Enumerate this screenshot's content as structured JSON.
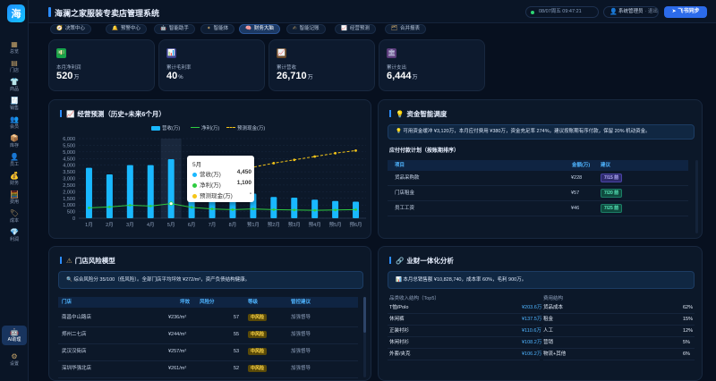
{
  "app": {
    "logo": "海",
    "title": "海澜之家服装专卖店管理系统",
    "datetime": "08/07周五 09:47:21",
    "user": "系统管理员",
    "logout": "· 退出",
    "feishu_btn": "飞书同步"
  },
  "sidebar": {
    "items": [
      {
        "label": "总览",
        "icon": "▦"
      },
      {
        "label": "门店",
        "icon": "▤"
      },
      {
        "label": "商品",
        "icon": "👕"
      },
      {
        "label": "销售",
        "icon": "🧾"
      },
      {
        "label": "会员",
        "icon": "👥"
      },
      {
        "label": "库存",
        "icon": "📦"
      },
      {
        "label": "员工",
        "icon": "👤"
      },
      {
        "label": "财务",
        "icon": "💰"
      },
      {
        "label": "费用",
        "icon": "🧮"
      },
      {
        "label": "成本",
        "icon": "🏷"
      },
      {
        "label": "利润",
        "icon": "💎"
      },
      {
        "label": "AI助理",
        "icon": "🤖"
      },
      {
        "label": "设置",
        "icon": "⚙"
      }
    ]
  },
  "tabs": [
    {
      "label": "决策中心",
      "icon": "🧭"
    },
    {
      "label": "预警中心",
      "icon": "🔔"
    },
    {
      "label": "智能助手",
      "icon": "🤖"
    },
    {
      "label": "智能体",
      "icon": "✦"
    },
    {
      "label": "财务大脑",
      "icon": "🧠"
    },
    {
      "label": "智能记账",
      "icon": "✍"
    },
    {
      "label": "经营预测",
      "icon": "📈"
    },
    {
      "label": "合并报表",
      "icon": "🗂"
    }
  ],
  "kpis": [
    {
      "label": "本月净利润",
      "value": "520",
      "unit": "万",
      "icon": "💵",
      "color": "#17a34a"
    },
    {
      "label": "累计毛利率",
      "value": "40",
      "unit": "%",
      "icon": "📊",
      "color": "#3a3f8f"
    },
    {
      "label": "累计营收",
      "value": "26,710",
      "unit": "万",
      "icon": "📈",
      "color": "#6b4a2a"
    },
    {
      "label": "累计支出",
      "value": "6,444",
      "unit": "万",
      "icon": "🏛",
      "color": "#5a3b7a"
    }
  ],
  "forecast": {
    "title": "经营预测（历史+未来6个月）",
    "icon": "📈",
    "legend": [
      "营收(万)",
      "净利(万)",
      "预测现金(万)"
    ],
    "tooltip": {
      "month": "5月",
      "rows": [
        {
          "name": "营收(万)",
          "value": "4,450",
          "color": "#19b8ff"
        },
        {
          "name": "净利(万)",
          "value": "1,100",
          "color": "#2ecc40"
        },
        {
          "name": "预测现金(万)",
          "value": "-",
          "color": "#f5c518"
        }
      ]
    }
  },
  "chart_data": {
    "type": "bar",
    "categories": [
      "1月",
      "2月",
      "3月",
      "4月",
      "5月",
      "6月",
      "7月",
      "8月",
      "预1月",
      "预2月",
      "预3月",
      "预4月",
      "预5月",
      "预6月"
    ],
    "ylim": [
      0,
      6000
    ],
    "yticks": [
      "0",
      "500",
      "1,000",
      "1,500",
      "2,000",
      "2,500",
      "3,000",
      "3,500",
      "4,000",
      "4,500",
      "5,000",
      "5,500",
      "6,000"
    ],
    "series": [
      {
        "name": "营收(万)",
        "type": "bar",
        "color": "#19b8ff",
        "values": [
          3800,
          3300,
          4000,
          4000,
          4450,
          3300,
          2350,
          2200,
          1850,
          1600,
          1550,
          1400,
          1300,
          1250
        ]
      },
      {
        "name": "净利(万)",
        "type": "line",
        "color": "#2ecc40",
        "values": [
          780,
          850,
          980,
          920,
          1100,
          820,
          700,
          650,
          700,
          650,
          620,
          600,
          620,
          650
        ]
      },
      {
        "name": "预测现金(万)",
        "type": "line-dashed",
        "color": "#f5c518",
        "values": [
          null,
          null,
          null,
          null,
          null,
          null,
          null,
          3400,
          3850,
          4150,
          4400,
          4650,
          4900,
          5100
        ]
      }
    ]
  },
  "capital": {
    "title": "资金智能调度",
    "icon": "💡",
    "notice": "💡 可用资金缓冲 ¥3,120万，本月应付费用 ¥380万，资金充足率 274%，建议按账期有序付款，保留 20% 机动资金。",
    "plan_title": "应付付款计划（按账期排序）",
    "columns": [
      "项目",
      "金额(万)",
      "建议"
    ],
    "rows": [
      {
        "item": "货品采购款",
        "amount": "¥228",
        "date": "7/15 前",
        "badge": "purple"
      },
      {
        "item": "门店租金",
        "amount": "¥57",
        "date": "7/20 前",
        "badge": "green"
      },
      {
        "item": "员工工资",
        "amount": "¥46",
        "date": "7/25 前",
        "badge": "green"
      }
    ]
  },
  "risk": {
    "title": "门店风险模型",
    "icon": "⚠",
    "notice": "🔍 综合风险分 35/100（低风险）。全部门店平均坪效 ¥272/m²，资产负债结构健康。",
    "columns": [
      "门店",
      "坪效",
      "风险分",
      "等级",
      "管控建议"
    ],
    "rows": [
      {
        "store": "南昌中山路店",
        "eff": "¥236/m²",
        "score": "57",
        "level": "中风险",
        "advice": "加强督导"
      },
      {
        "store": "郑州二七店",
        "eff": "¥244/m²",
        "score": "55",
        "level": "中风险",
        "advice": "加强督导"
      },
      {
        "store": "武汉汉街店",
        "eff": "¥257/m²",
        "score": "53",
        "level": "中风险",
        "advice": "加强督导"
      },
      {
        "store": "深圳华强北店",
        "eff": "¥261/m²",
        "score": "52",
        "level": "中风险",
        "advice": "加强督导"
      }
    ]
  },
  "bizfin": {
    "title": "业财一体化分析",
    "icon": "🔗",
    "notice": "📊 本月总销售额 ¥10,828,740，成本率 60%，毛利 900万。",
    "left_head": "品类收入结构（Top5）",
    "right_head": "费用结构",
    "left_rows": [
      {
        "name": "T恤/Polo",
        "value": "¥203.6万"
      },
      {
        "name": "休闲裤",
        "value": "¥137.5万"
      },
      {
        "name": "正装衬衫",
        "value": "¥110.6万"
      },
      {
        "name": "休闲衬衫",
        "value": "¥108.2万"
      },
      {
        "name": "外套/夹克",
        "value": "¥106.2万"
      }
    ],
    "right_rows": [
      {
        "name": "货品成本",
        "value": "62%"
      },
      {
        "name": "租金",
        "value": "15%"
      },
      {
        "name": "人工",
        "value": "12%"
      },
      {
        "name": "营销",
        "value": "5%"
      },
      {
        "name": "物流+其他",
        "value": "6%"
      }
    ]
  }
}
